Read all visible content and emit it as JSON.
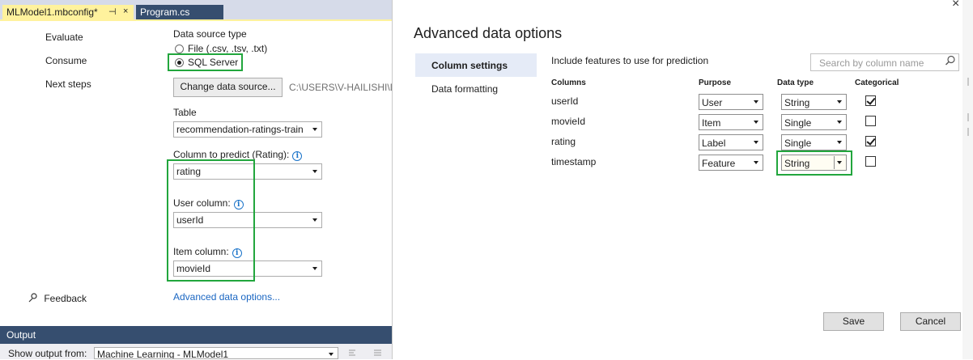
{
  "tabs": [
    {
      "label": "MLModel1.mbconfig*",
      "pin": "⊣",
      "close": "×"
    },
    {
      "label": "Program.cs"
    }
  ],
  "steps": [
    "Evaluate",
    "Consume",
    "Next steps"
  ],
  "data_source": {
    "heading": "Data source type",
    "option_file": "File (.csv, .tsv, .txt)",
    "option_sql": "SQL Server",
    "change_button": "Change data source...",
    "path": "C:\\USERS\\V-HAILISHI\\DI"
  },
  "table": {
    "label": "Table",
    "value": "recommendation-ratings-train"
  },
  "predict": {
    "label": "Column to predict (Rating):",
    "value": "rating"
  },
  "user_col": {
    "label": "User column:",
    "value": "userId"
  },
  "item_col": {
    "label": "Item column:",
    "value": "movieId"
  },
  "info_glyph": "i",
  "feedback": "Feedback",
  "advanced_link": "Advanced data options...",
  "output": {
    "title": "Output",
    "show_from_label": "Show output from:",
    "show_from_value": "Machine Learning - MLModel1"
  },
  "dialog": {
    "title": "Advanced data options",
    "close": "×",
    "nav": [
      "Column settings",
      "Data formatting"
    ],
    "include_text": "Include features to use for prediction",
    "search_placeholder": "Search by column name",
    "headers": {
      "columns": "Columns",
      "purpose": "Purpose",
      "data_type": "Data type",
      "categorical": "Categorical"
    },
    "rows": [
      {
        "name": "userId",
        "purpose": "User",
        "type": "String",
        "categorical": true
      },
      {
        "name": "movieId",
        "purpose": "Item",
        "type": "Single",
        "categorical": false
      },
      {
        "name": "rating",
        "purpose": "Label",
        "type": "Single",
        "categorical": true
      },
      {
        "name": "timestamp",
        "purpose": "Feature",
        "type": "String",
        "categorical": false
      }
    ],
    "save": "Save",
    "cancel": "Cancel"
  },
  "colors": {
    "highlight_box": "#22a63d",
    "active_tab": "#fff29d",
    "link": "#1a66c2",
    "tool_window_title": "#364e6f"
  }
}
